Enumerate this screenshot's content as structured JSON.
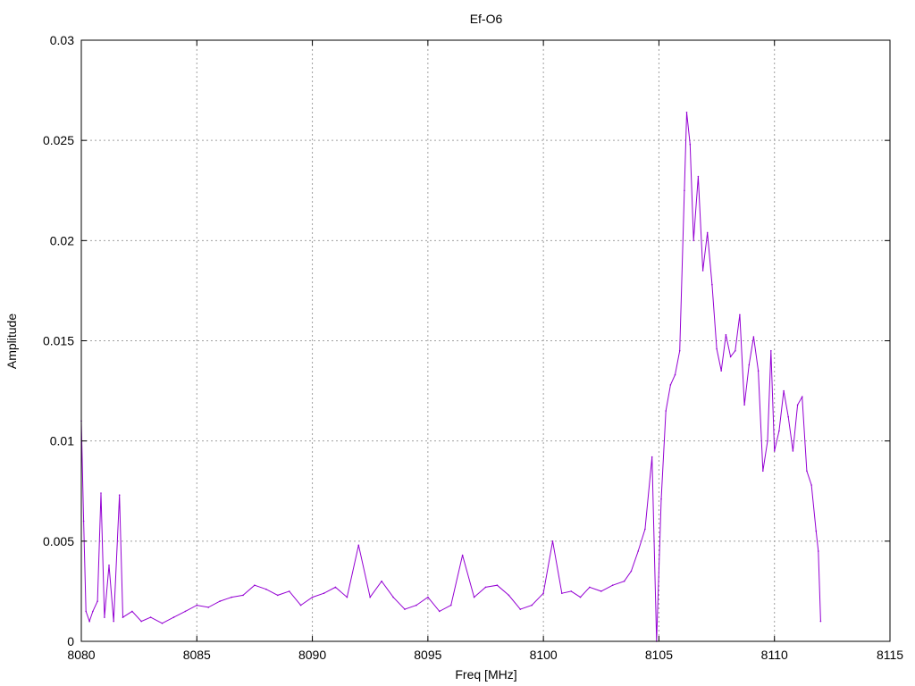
{
  "chart_data": {
    "type": "line",
    "title": "Ef-O6",
    "xlabel": "Freq [MHz]",
    "ylabel": "Amplitude",
    "xlim": [
      8080,
      8115
    ],
    "ylim": [
      0,
      0.03
    ],
    "x_ticks": [
      "8080",
      "8085",
      "8090",
      "8095",
      "8100",
      "8105",
      "8110",
      "8115"
    ],
    "y_ticks": [
      "0",
      "0.005",
      "0.01",
      "0.015",
      "0.02",
      "0.025",
      "0.03"
    ],
    "grid": true,
    "legend": "none",
    "series": [
      {
        "color": "#9400d3",
        "points": [
          [
            8080.0,
            0.011
          ],
          [
            8080.1,
            0.006
          ],
          [
            8080.2,
            0.0015
          ],
          [
            8080.35,
            0.001
          ],
          [
            8080.5,
            0.0015
          ],
          [
            8080.7,
            0.002
          ],
          [
            8080.85,
            0.0074
          ],
          [
            8081.0,
            0.0012
          ],
          [
            8081.2,
            0.0038
          ],
          [
            8081.4,
            0.001
          ],
          [
            8081.65,
            0.0073
          ],
          [
            8081.8,
            0.0012
          ],
          [
            8082.2,
            0.0015
          ],
          [
            8082.6,
            0.001
          ],
          [
            8083.0,
            0.0012
          ],
          [
            8083.5,
            0.0009
          ],
          [
            8084.0,
            0.0012
          ],
          [
            8084.5,
            0.0015
          ],
          [
            8085.0,
            0.0018
          ],
          [
            8085.5,
            0.0017
          ],
          [
            8086.0,
            0.002
          ],
          [
            8086.5,
            0.0022
          ],
          [
            8087.0,
            0.0023
          ],
          [
            8087.5,
            0.0028
          ],
          [
            8088.0,
            0.0026
          ],
          [
            8088.5,
            0.0023
          ],
          [
            8089.0,
            0.0025
          ],
          [
            8089.5,
            0.0018
          ],
          [
            8090.0,
            0.0022
          ],
          [
            8090.5,
            0.0024
          ],
          [
            8091.0,
            0.0027
          ],
          [
            8091.5,
            0.0022
          ],
          [
            8092.0,
            0.0048
          ],
          [
            8092.5,
            0.0022
          ],
          [
            8093.0,
            0.003
          ],
          [
            8093.5,
            0.0022
          ],
          [
            8094.0,
            0.0016
          ],
          [
            8094.5,
            0.0018
          ],
          [
            8095.0,
            0.0022
          ],
          [
            8095.5,
            0.0015
          ],
          [
            8096.0,
            0.0018
          ],
          [
            8096.5,
            0.0043
          ],
          [
            8097.0,
            0.0022
          ],
          [
            8097.5,
            0.0027
          ],
          [
            8098.0,
            0.0028
          ],
          [
            8098.5,
            0.0023
          ],
          [
            8099.0,
            0.0016
          ],
          [
            8099.5,
            0.0018
          ],
          [
            8100.0,
            0.0024
          ],
          [
            8100.4,
            0.005
          ],
          [
            8100.8,
            0.0024
          ],
          [
            8101.2,
            0.0025
          ],
          [
            8101.6,
            0.0022
          ],
          [
            8102.0,
            0.0027
          ],
          [
            8102.5,
            0.0025
          ],
          [
            8103.0,
            0.0028
          ],
          [
            8103.5,
            0.003
          ],
          [
            8103.8,
            0.0035
          ],
          [
            8104.1,
            0.0045
          ],
          [
            8104.4,
            0.0056
          ],
          [
            8104.7,
            0.0092
          ],
          [
            8104.9,
            0.0
          ],
          [
            8105.1,
            0.0071
          ],
          [
            8105.3,
            0.0115
          ],
          [
            8105.5,
            0.0128
          ],
          [
            8105.7,
            0.0133
          ],
          [
            8105.9,
            0.0145
          ],
          [
            8106.1,
            0.0225
          ],
          [
            8106.2,
            0.0264
          ],
          [
            8106.35,
            0.0248
          ],
          [
            8106.5,
            0.02
          ],
          [
            8106.7,
            0.0232
          ],
          [
            8106.9,
            0.0185
          ],
          [
            8107.1,
            0.0204
          ],
          [
            8107.3,
            0.0178
          ],
          [
            8107.5,
            0.0146
          ],
          [
            8107.7,
            0.0135
          ],
          [
            8107.9,
            0.0153
          ],
          [
            8108.1,
            0.0142
          ],
          [
            8108.3,
            0.0145
          ],
          [
            8108.5,
            0.0163
          ],
          [
            8108.7,
            0.0118
          ],
          [
            8108.9,
            0.0138
          ],
          [
            8109.1,
            0.0152
          ],
          [
            8109.3,
            0.0135
          ],
          [
            8109.5,
            0.0085
          ],
          [
            8109.7,
            0.01
          ],
          [
            8109.85,
            0.0145
          ],
          [
            8110.0,
            0.0095
          ],
          [
            8110.2,
            0.0105
          ],
          [
            8110.4,
            0.0125
          ],
          [
            8110.6,
            0.0112
          ],
          [
            8110.8,
            0.0095
          ],
          [
            8111.0,
            0.0118
          ],
          [
            8111.2,
            0.0122
          ],
          [
            8111.4,
            0.0085
          ],
          [
            8111.6,
            0.0078
          ],
          [
            8111.8,
            0.0055
          ],
          [
            8111.9,
            0.0045
          ],
          [
            8112.0,
            0.001
          ]
        ]
      }
    ]
  }
}
